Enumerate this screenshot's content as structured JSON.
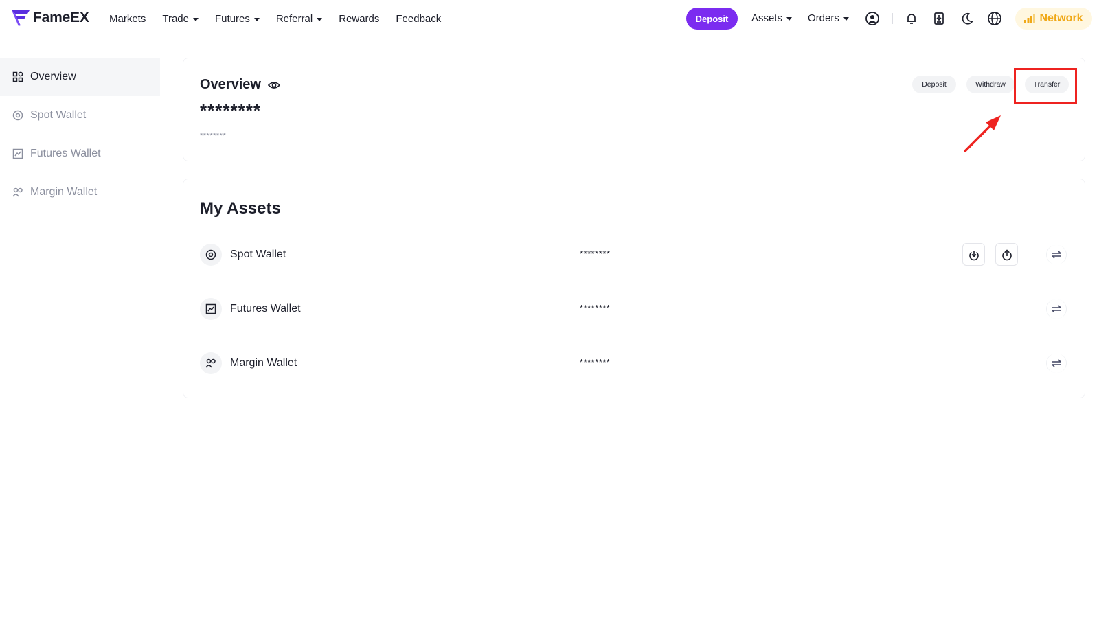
{
  "brand": {
    "name": "FameEX",
    "color": "#5a2ee0"
  },
  "nav": {
    "items": [
      {
        "label": "Markets",
        "dropdown": false
      },
      {
        "label": "Trade",
        "dropdown": true
      },
      {
        "label": "Futures",
        "dropdown": true
      },
      {
        "label": "Referral",
        "dropdown": true
      },
      {
        "label": "Rewards",
        "dropdown": false
      },
      {
        "label": "Feedback",
        "dropdown": false
      }
    ]
  },
  "header": {
    "deposit_label": "Deposit",
    "assets_label": "Assets",
    "orders_label": "Orders",
    "network_label": "Network",
    "icons": [
      "user-icon",
      "bell-icon",
      "download-app-icon",
      "moon-icon",
      "globe-icon",
      "signal-icon"
    ],
    "accent_color": "#7b2cf0",
    "network_color": "#f0a817"
  },
  "sidebar": {
    "items": [
      {
        "label": "Overview",
        "icon": "grid-icon",
        "active": true
      },
      {
        "label": "Spot Wallet",
        "icon": "target-icon",
        "active": false
      },
      {
        "label": "Futures Wallet",
        "icon": "chart-icon",
        "active": false
      },
      {
        "label": "Margin Wallet",
        "icon": "users-icon",
        "active": false
      }
    ]
  },
  "overview": {
    "title": "Overview",
    "balance_masked": "********",
    "sub_masked": "********",
    "buttons": {
      "deposit": "Deposit",
      "withdraw": "Withdraw",
      "transfer": "Transfer"
    },
    "annotation_color": "#ee2320"
  },
  "assets": {
    "title": "My Assets",
    "rows": [
      {
        "name": "Spot Wallet",
        "value": "********",
        "icon": "target-icon",
        "actions": [
          "deposit-icon",
          "withdraw-icon",
          "transfer-icon"
        ]
      },
      {
        "name": "Futures Wallet",
        "value": "********",
        "icon": "chart-icon",
        "actions": [
          "transfer-icon"
        ]
      },
      {
        "name": "Margin Wallet",
        "value": "********",
        "icon": "users-icon",
        "actions": [
          "transfer-icon"
        ]
      }
    ]
  }
}
